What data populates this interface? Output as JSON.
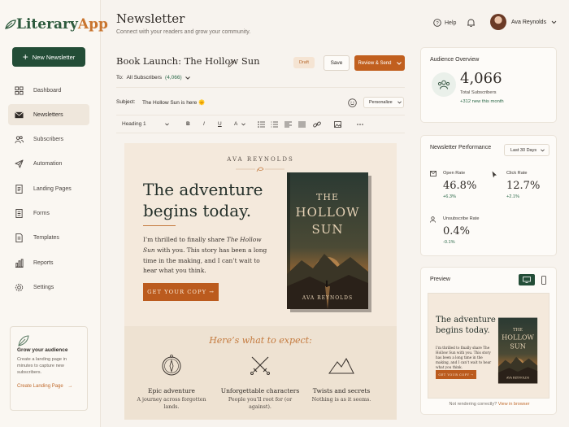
{
  "app": {
    "logo_part1": "Literary",
    "logo_part2": "App"
  },
  "sidebar": {
    "new_button": "New Newsletter",
    "items": [
      {
        "label": "Dashboard",
        "icon": "grid-icon"
      },
      {
        "label": "Newsletters",
        "icon": "mail-icon",
        "active": true
      },
      {
        "label": "Subscribers",
        "icon": "users-icon"
      },
      {
        "label": "Automation",
        "icon": "send-icon"
      },
      {
        "label": "Landing Pages",
        "icon": "page-icon"
      },
      {
        "label": "Forms",
        "icon": "form-icon"
      },
      {
        "label": "Templates",
        "icon": "template-icon"
      },
      {
        "label": "Reports",
        "icon": "bar-chart-icon"
      },
      {
        "label": "Settings",
        "icon": "gear-icon"
      }
    ],
    "grow": {
      "title": "Grow your audience",
      "description": "Create a landing page in minutes to capture new subscribers.",
      "link": "Create Landing Page",
      "link_arrow": "→"
    }
  },
  "header": {
    "title": "Newsletter",
    "subtitle": "Connect with your readers and grow your community.",
    "help": "Help",
    "user_name": "Ava Reynolds"
  },
  "editor": {
    "title": "Book Launch: The Hollow Sun",
    "status": "Draft",
    "save": "Save",
    "review": "Review & Send",
    "to_label": "To:",
    "to_value": "All Subscribers",
    "to_count": "(4,066)",
    "subject_label": "Subject:",
    "subject_value": "The Hollow Sun is here 🌞",
    "personalize": "Personalize",
    "toolbar": {
      "style": "Heading 1",
      "bold": "B",
      "italic": "I",
      "underline": "U",
      "text_color": "A"
    }
  },
  "email": {
    "author": "AVA REYNOLDS",
    "headline_1": "The adventure",
    "headline_2": "begins today.",
    "body_1": "I’m thrilled to finally share ",
    "body_italic": "The Hollow Sun",
    "body_2": " with you. This story has been a long time in the making, and I can’t wait to hear what you think.",
    "cta": "GET YOUR COPY →",
    "book_title_1": "THE",
    "book_title_2": "HOLLOW",
    "book_title_3": "SUN",
    "book_author": "AVA REYNOLDS",
    "expect": "Here’s what to expect:",
    "features": [
      {
        "title": "Epic adventure",
        "desc": "A journey across forgotten lands.",
        "icon": "compass-icon"
      },
      {
        "title": "Unforgettable characters",
        "desc": "People you’ll root for (or against).",
        "icon": "crossed-swords-icon"
      },
      {
        "title": "Twists and secrets",
        "desc": "Nothing is as it seems.",
        "icon": "mountains-icon"
      }
    ]
  },
  "audience": {
    "title": "Audience Overview",
    "total": "4,066",
    "total_label": "Total Subscribers",
    "new_this_month": "+312 new this month"
  },
  "performance": {
    "title": "Newsletter Performance",
    "range": "Last 30 Days",
    "open_rate_label": "Open Rate",
    "open_rate": "46.8%",
    "open_delta": "+6.3%",
    "click_rate_label": "Click Rate",
    "click_rate": "12.7%",
    "click_delta": "+2.1%",
    "unsub_label": "Unsubscribe Rate",
    "unsub_rate": "0.4%",
    "unsub_delta": "-0.1%"
  },
  "preview": {
    "title": "Preview",
    "headline_1": "The adventure",
    "headline_2": "begins today.",
    "body": "I’m thrilled to finally share The Hollow Sun with you. This story has been a long time in the making, and I can’t wait to hear what you think.",
    "cta": "GET YOUR COPY →",
    "footer_text": "Not rendering correctly?",
    "footer_link": "View in browser"
  },
  "colors": {
    "brand_green": "#234d37",
    "accent_orange": "#c15f1e",
    "positive": "#2d6a4a"
  }
}
